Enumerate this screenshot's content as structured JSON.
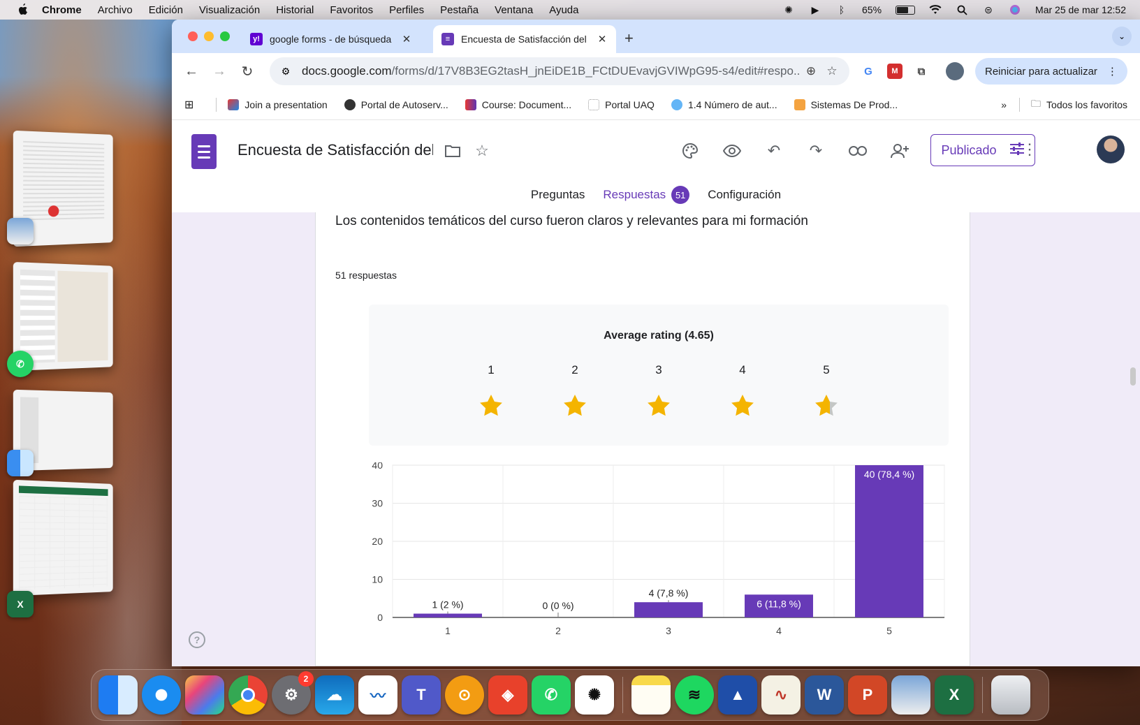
{
  "menubar": {
    "app": "Chrome",
    "items": [
      "Archivo",
      "Edición",
      "Visualización",
      "Historial",
      "Favoritos",
      "Perfiles",
      "Pestaña",
      "Ventana",
      "Ayuda"
    ],
    "battery": "65%",
    "datetime": "Mar 25 de mar  12:52"
  },
  "browser": {
    "tabs": [
      {
        "title": "google forms - de búsqueda",
        "favicon_color": "#6001d2"
      },
      {
        "title": "Encuesta de Satisfacción del",
        "favicon_color": "#673ab7"
      }
    ],
    "url_host": "docs.google.com",
    "url_path": "/forms/d/17V8B3EG2tasH_jnEiDE1B_FCtDUEvavjGVIWpG95-s4/edit#respo...",
    "relaunch_label": "Reiniciar para actualizar",
    "bookmarks": [
      "Join a presentation",
      "Portal de Autoserv...",
      "Course: Document...",
      "Portal UAQ",
      "1.4 Número de aut...",
      "Sistemas De Prod..."
    ],
    "all_bookmarks": "Todos los favoritos"
  },
  "form": {
    "title": "Encuesta de Satisfacción del",
    "publish_label": "Publicado",
    "tabs": {
      "questions": "Preguntas",
      "responses": "Respuestas",
      "responses_count": "51",
      "settings": "Configuración"
    },
    "question": "Los contenidos temáticos del curso fueron claros y relevantes para mi formación",
    "response_count_text": "51 respuestas",
    "average_label": "Average rating (4.65)",
    "average_value": 4.65,
    "rating_levels": [
      "1",
      "2",
      "3",
      "4",
      "5"
    ]
  },
  "chart_data": {
    "type": "bar",
    "categories": [
      "1",
      "2",
      "3",
      "4",
      "5"
    ],
    "values": [
      1,
      0,
      4,
      6,
      40
    ],
    "labels": [
      "1 (2 %)",
      "0 (0 %)",
      "4 (7,8 %)",
      "6 (11,8 %)",
      "40 (78,4 %)"
    ],
    "yticks": [
      "0",
      "10",
      "20",
      "30",
      "40"
    ],
    "ylim": [
      0,
      40
    ],
    "color": "#673ab7",
    "grid": true
  },
  "colors": {
    "accent": "#673ab7",
    "star": "#f4b400"
  }
}
